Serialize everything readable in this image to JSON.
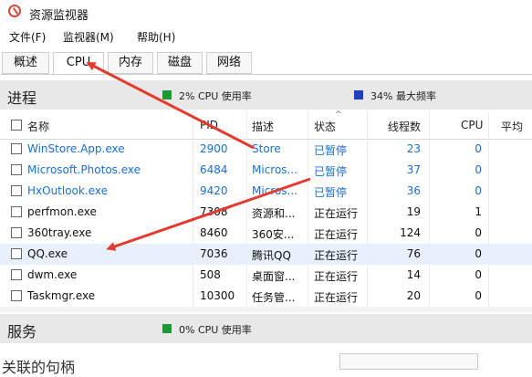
{
  "window": {
    "title": "资源监视器"
  },
  "menu": [
    {
      "label": "文件(F)"
    },
    {
      "label": "监视器(M)"
    },
    {
      "label": "帮助(H)"
    }
  ],
  "tabs": [
    {
      "label": "概述"
    },
    {
      "label": "CPU"
    },
    {
      "label": "内存"
    },
    {
      "label": "磁盘"
    },
    {
      "label": "网络"
    }
  ],
  "process_section": {
    "title": "进程",
    "legend1": "2% CPU 使用率",
    "legend2": "34% 最大频率",
    "legend1_color": "#1a9a30",
    "legend2_color": "#1f3fc4",
    "columns": [
      "名称",
      "PID",
      "描述",
      "状态",
      "线程数",
      "CPU",
      "平均"
    ],
    "rows": [
      {
        "name": "WinStore.App.exe",
        "pid": "2900",
        "desc": "Store",
        "status": "已暂停",
        "threads": "23",
        "cpu": "0",
        "suspended": true
      },
      {
        "name": "Microsoft.Photos.exe",
        "pid": "6484",
        "desc": "Micros...",
        "status": "已暂停",
        "threads": "37",
        "cpu": "0",
        "suspended": true
      },
      {
        "name": "HxOutlook.exe",
        "pid": "9420",
        "desc": "Micros...",
        "status": "已暂停",
        "threads": "36",
        "cpu": "0",
        "suspended": true
      },
      {
        "name": "perfmon.exe",
        "pid": "7308",
        "desc": "资源和...",
        "status": "正在运行",
        "threads": "19",
        "cpu": "1",
        "suspended": false
      },
      {
        "name": "360tray.exe",
        "pid": "8460",
        "desc": "360安...",
        "status": "正在运行",
        "threads": "124",
        "cpu": "0",
        "suspended": false
      },
      {
        "name": "QQ.exe",
        "pid": "7036",
        "desc": "腾讯QQ",
        "status": "正在运行",
        "threads": "76",
        "cpu": "0",
        "suspended": false,
        "highlighted": true
      },
      {
        "name": "dwm.exe",
        "pid": "508",
        "desc": "桌面窗...",
        "status": "正在运行",
        "threads": "14",
        "cpu": "0",
        "suspended": false
      },
      {
        "name": "Taskmgr.exe",
        "pid": "10300",
        "desc": "任务管...",
        "status": "正在运行",
        "threads": "20",
        "cpu": "0",
        "suspended": false
      }
    ]
  },
  "services_section": {
    "title": "服务",
    "legend": "0% CPU 使用率",
    "legend_color": "#1a9a30"
  },
  "bottom": {
    "fragment": "关联的句柄"
  },
  "annotations": {
    "arrow_color": "#e53a2e"
  }
}
